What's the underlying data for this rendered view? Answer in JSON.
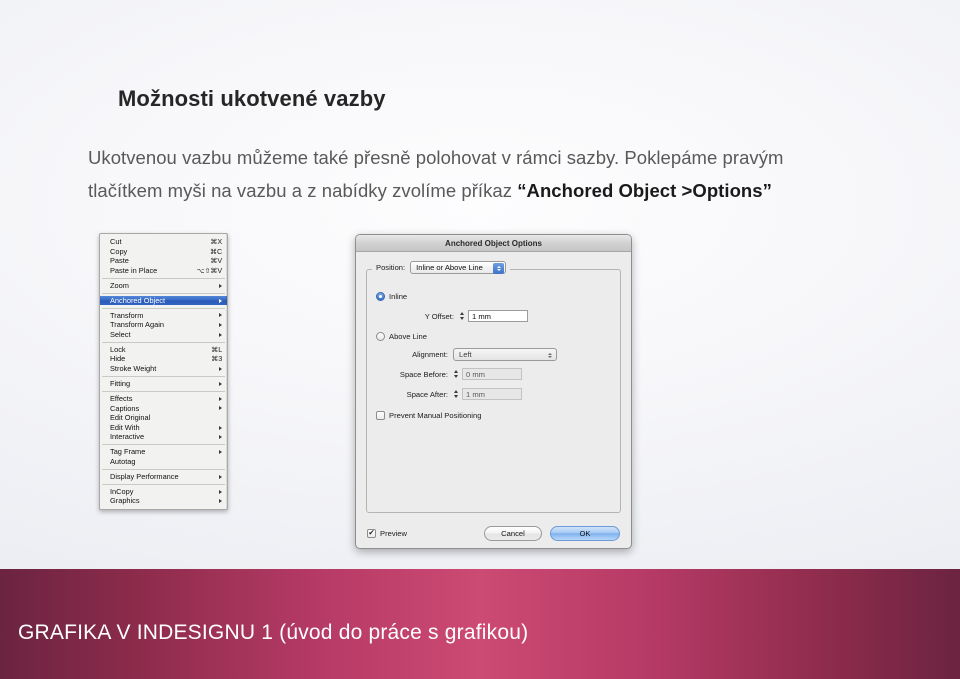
{
  "slide": {
    "title": "Možnosti ukotvené vazby",
    "body_line1": "Ukotvenou vazbu můžeme také přesně polohovat v rámci sazby. Poklepáme pravým",
    "body_line2_prefix": "tlačítkem myši na vazbu a z nabídky zvolíme příkaz ",
    "body_line2_bold": "“Anchored Object >Options”",
    "footer_text": "GRAFIKA V INDESIGNU 1 (úvod do práce s grafikou)",
    "accent_color": "#cc4a74",
    "accent_dark_color": "#6b2440",
    "title_color": "#262626",
    "body_color": "#595959"
  },
  "context_menu": {
    "name": "indesign-context-menu",
    "highlight_color": "#3466c4",
    "groups": [
      {
        "items": [
          {
            "label": "Cut",
            "shortcut": "⌘X",
            "submenu": false,
            "selected": false
          },
          {
            "label": "Copy",
            "shortcut": "⌘C",
            "submenu": false,
            "selected": false
          },
          {
            "label": "Paste",
            "shortcut": "⌘V",
            "submenu": false,
            "selected": false
          },
          {
            "label": "Paste in Place",
            "shortcut": "⌥⇧⌘V",
            "submenu": false,
            "selected": false
          }
        ]
      },
      {
        "items": [
          {
            "label": "Zoom",
            "shortcut": "",
            "submenu": true,
            "selected": false
          }
        ]
      },
      {
        "items": [
          {
            "label": "Anchored Object",
            "shortcut": "",
            "submenu": true,
            "selected": true
          }
        ]
      },
      {
        "items": [
          {
            "label": "Transform",
            "shortcut": "",
            "submenu": true,
            "selected": false
          },
          {
            "label": "Transform Again",
            "shortcut": "",
            "submenu": true,
            "selected": false
          },
          {
            "label": "Select",
            "shortcut": "",
            "submenu": true,
            "selected": false
          }
        ]
      },
      {
        "items": [
          {
            "label": "Lock",
            "shortcut": "⌘L",
            "submenu": false,
            "selected": false
          },
          {
            "label": "Hide",
            "shortcut": "⌘3",
            "submenu": false,
            "selected": false
          },
          {
            "label": "Stroke Weight",
            "shortcut": "",
            "submenu": true,
            "selected": false
          }
        ]
      },
      {
        "items": [
          {
            "label": "Fitting",
            "shortcut": "",
            "submenu": true,
            "selected": false
          }
        ]
      },
      {
        "items": [
          {
            "label": "Effects",
            "shortcut": "",
            "submenu": true,
            "selected": false
          },
          {
            "label": "Captions",
            "shortcut": "",
            "submenu": true,
            "selected": false
          },
          {
            "label": "Edit Original",
            "shortcut": "",
            "submenu": false,
            "selected": false
          },
          {
            "label": "Edit With",
            "shortcut": "",
            "submenu": true,
            "selected": false
          },
          {
            "label": "Interactive",
            "shortcut": "",
            "submenu": true,
            "selected": false
          }
        ]
      },
      {
        "items": [
          {
            "label": "Tag Frame",
            "shortcut": "",
            "submenu": true,
            "selected": false
          },
          {
            "label": "Autotag",
            "shortcut": "",
            "submenu": false,
            "selected": false
          }
        ]
      },
      {
        "items": [
          {
            "label": "Display Performance",
            "shortcut": "",
            "submenu": true,
            "selected": false
          }
        ]
      },
      {
        "items": [
          {
            "label": "InCopy",
            "shortcut": "",
            "submenu": true,
            "selected": false
          },
          {
            "label": "Graphics",
            "shortcut": "",
            "submenu": true,
            "selected": false
          }
        ]
      }
    ]
  },
  "dialog": {
    "title": "Anchored Object Options",
    "position_label": "Position:",
    "position_value": "Inline or Above Line",
    "inline_label": "Inline",
    "inline_selected": true,
    "y_offset_label": "Y Offset:",
    "y_offset_value": "1 mm",
    "above_line_label": "Above Line",
    "above_line_selected": false,
    "alignment_label": "Alignment:",
    "alignment_value": "Left",
    "space_before_label": "Space Before:",
    "space_before_value": "0 mm",
    "space_after_label": "Space After:",
    "space_after_value": "1 mm",
    "prevent_label": "Prevent Manual Positioning",
    "prevent_checked": false,
    "preview_label": "Preview",
    "preview_checked": true,
    "cancel_label": "Cancel",
    "ok_label": "OK"
  }
}
